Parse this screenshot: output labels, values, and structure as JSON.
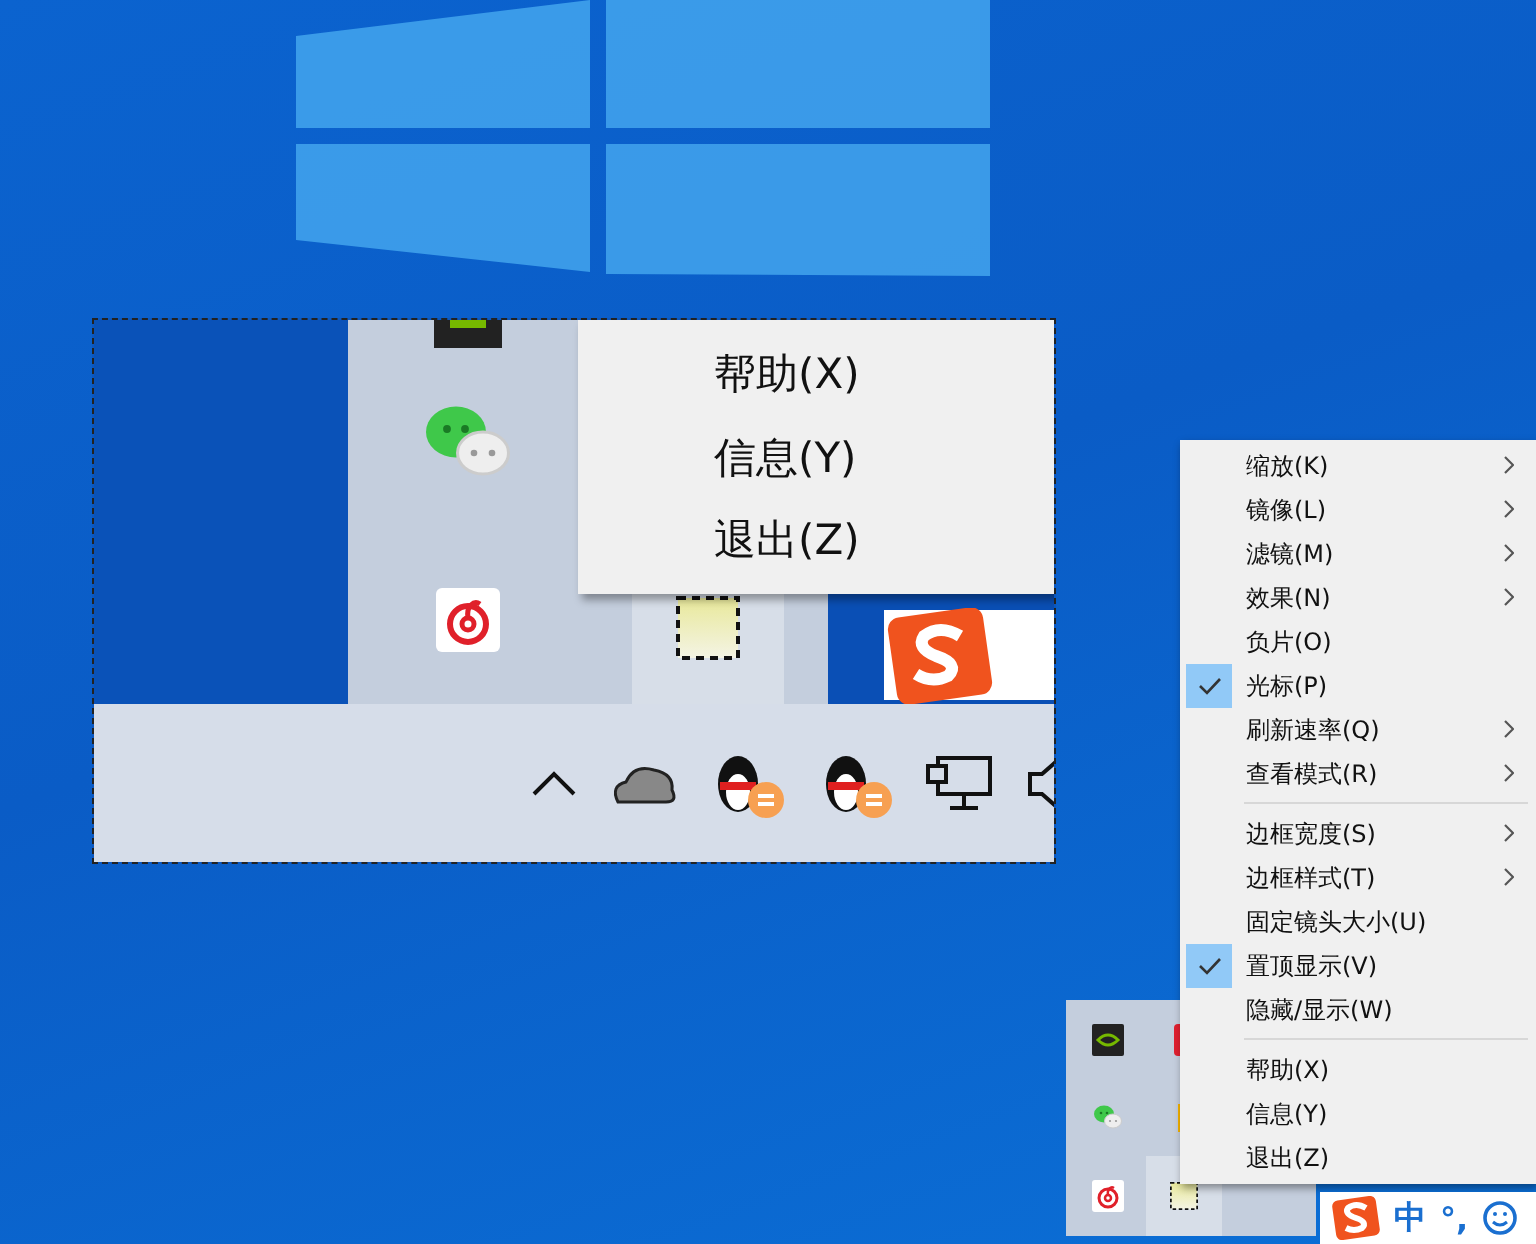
{
  "magnifier": {
    "menu_items": [
      "帮助(X)",
      "信息(Y)",
      "退出(Z)"
    ]
  },
  "context_menu": {
    "items": [
      {
        "kind": "item",
        "label": "缩放(K)",
        "checked": false,
        "submenu": true
      },
      {
        "kind": "item",
        "label": "镜像(L)",
        "checked": false,
        "submenu": true
      },
      {
        "kind": "item",
        "label": "滤镜(M)",
        "checked": false,
        "submenu": true
      },
      {
        "kind": "item",
        "label": "效果(N)",
        "checked": false,
        "submenu": true
      },
      {
        "kind": "item",
        "label": "负片(O)",
        "checked": false,
        "submenu": false
      },
      {
        "kind": "item",
        "label": "光标(P)",
        "checked": true,
        "submenu": false
      },
      {
        "kind": "item",
        "label": "刷新速率(Q)",
        "checked": false,
        "submenu": true
      },
      {
        "kind": "item",
        "label": "查看模式(R)",
        "checked": false,
        "submenu": true
      },
      {
        "kind": "separator"
      },
      {
        "kind": "item",
        "label": "边框宽度(S)",
        "checked": false,
        "submenu": true
      },
      {
        "kind": "item",
        "label": "边框样式(T)",
        "checked": false,
        "submenu": true
      },
      {
        "kind": "item",
        "label": "固定镜头大小(U)",
        "checked": false,
        "submenu": false
      },
      {
        "kind": "item",
        "label": "置顶显示(V)",
        "checked": true,
        "submenu": false
      },
      {
        "kind": "item",
        "label": "隐藏/显示(W)",
        "checked": false,
        "submenu": false
      },
      {
        "kind": "separator"
      },
      {
        "kind": "item",
        "label": "帮助(X)",
        "checked": false,
        "submenu": false
      },
      {
        "kind": "item",
        "label": "信息(Y)",
        "checked": false,
        "submenu": false
      },
      {
        "kind": "item",
        "label": "退出(Z)",
        "checked": false,
        "submenu": false
      }
    ]
  },
  "taskbar": {
    "ime_mode": "中",
    "punctuation": "°,"
  }
}
